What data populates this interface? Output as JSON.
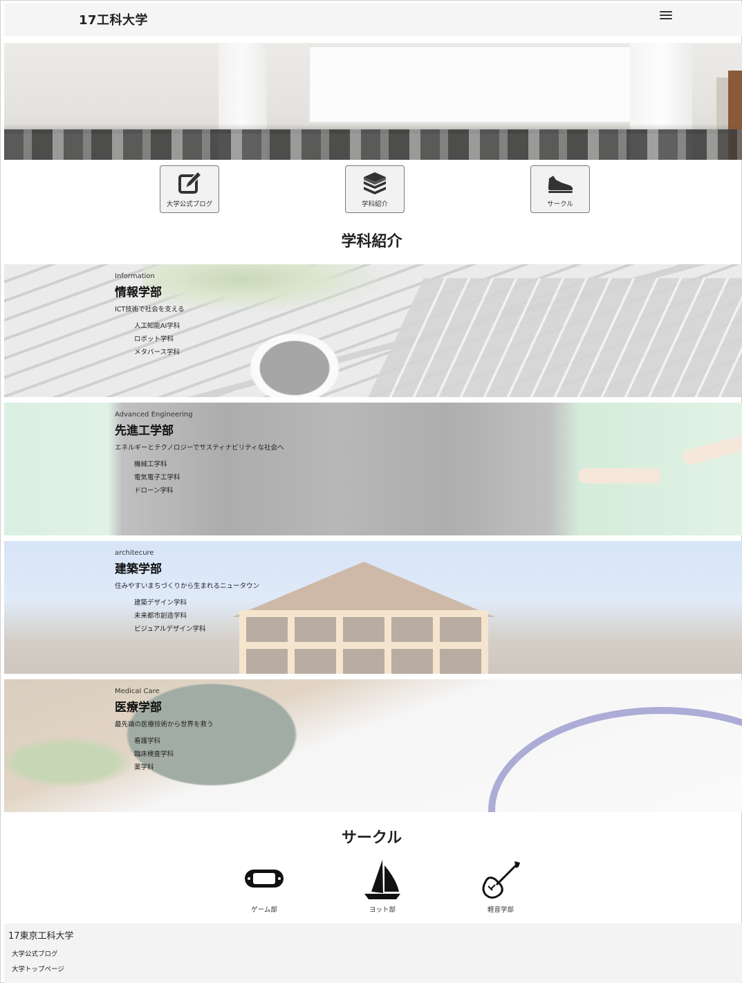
{
  "header": {
    "title": "17工科大学",
    "menu_icon": "hamburger-menu-icon"
  },
  "nav": {
    "blog_label": "大学公式ブログ",
    "dept_label": "学科紹介",
    "circle_label": "サークル"
  },
  "sections": {
    "departments_title": "学科紹介",
    "circles_title": "サークル"
  },
  "departments": [
    {
      "en": "Information",
      "name": "情報学部",
      "tagline": "ICT技術で社会を支える",
      "courses": [
        "人工知能AI学科",
        "ロボット学科",
        "メタバース学科"
      ]
    },
    {
      "en": "Advanced Engineering",
      "name": "先進工学部",
      "tagline": "エネルギーとテクノロジーでサスティナビリティな社会へ",
      "courses": [
        "機械工学科",
        "電気電子工学科",
        "ドローン学科"
      ]
    },
    {
      "en": "architecure",
      "name": "建築学部",
      "tagline": "住みやすいまちづくりから生まれるニュータウン",
      "courses": [
        "建築デザイン学科",
        "未来都市創造学科",
        "ビジュアルデザイン学科"
      ]
    },
    {
      "en": "Medical Care",
      "name": "医療学部",
      "tagline": "最先端の医療技術から世界を救う",
      "courses": [
        "看護学科",
        "臨床検査学科",
        "薬学科"
      ]
    }
  ],
  "circles": [
    {
      "label": "ゲーム部",
      "icon": "game-console-icon"
    },
    {
      "label": "ヨット部",
      "icon": "sailboat-icon"
    },
    {
      "label": "軽音学部",
      "icon": "electric-guitar-icon"
    }
  ],
  "footer": {
    "title": "17東京工科大学",
    "links": [
      "大学公式ブログ",
      "大学トップページ"
    ]
  }
}
